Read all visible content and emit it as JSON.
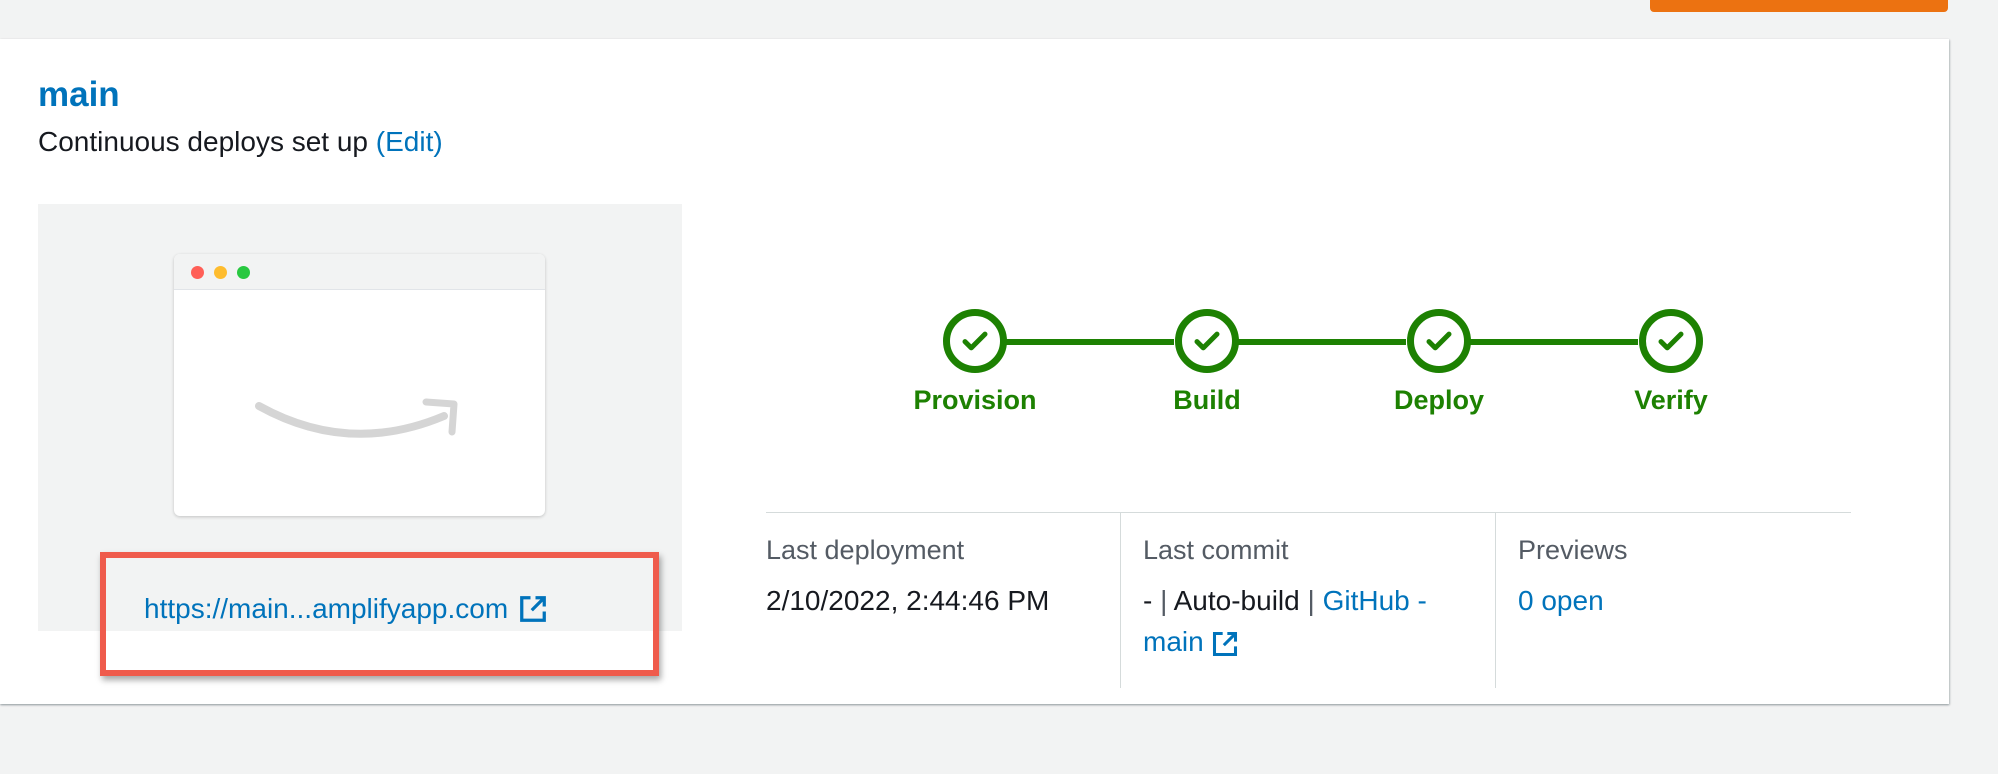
{
  "colors": {
    "link": "#0073bb",
    "success": "#1d8102",
    "highlight": "#ef5b4c",
    "primary_action": "#ec7211"
  },
  "branch": {
    "name": "main",
    "subtitle": "Continuous deploys set up",
    "edit_label": "(Edit)"
  },
  "preview": {
    "url": "https://main...amplifyapp.com",
    "icon": "external-link-icon"
  },
  "pipeline": {
    "steps": [
      {
        "label": "Provision",
        "status": "success"
      },
      {
        "label": "Build",
        "status": "success"
      },
      {
        "label": "Deploy",
        "status": "success"
      },
      {
        "label": "Verify",
        "status": "success"
      }
    ]
  },
  "details": {
    "last_deployment": {
      "label": "Last deployment",
      "value": "2/10/2022, 2:44:46 PM"
    },
    "last_commit": {
      "label": "Last commit",
      "dash": "-",
      "sep": "|",
      "commit_message": "Auto-build",
      "repo_link": "GitHub - main"
    },
    "previews": {
      "label": "Previews",
      "value": "0 open"
    }
  }
}
